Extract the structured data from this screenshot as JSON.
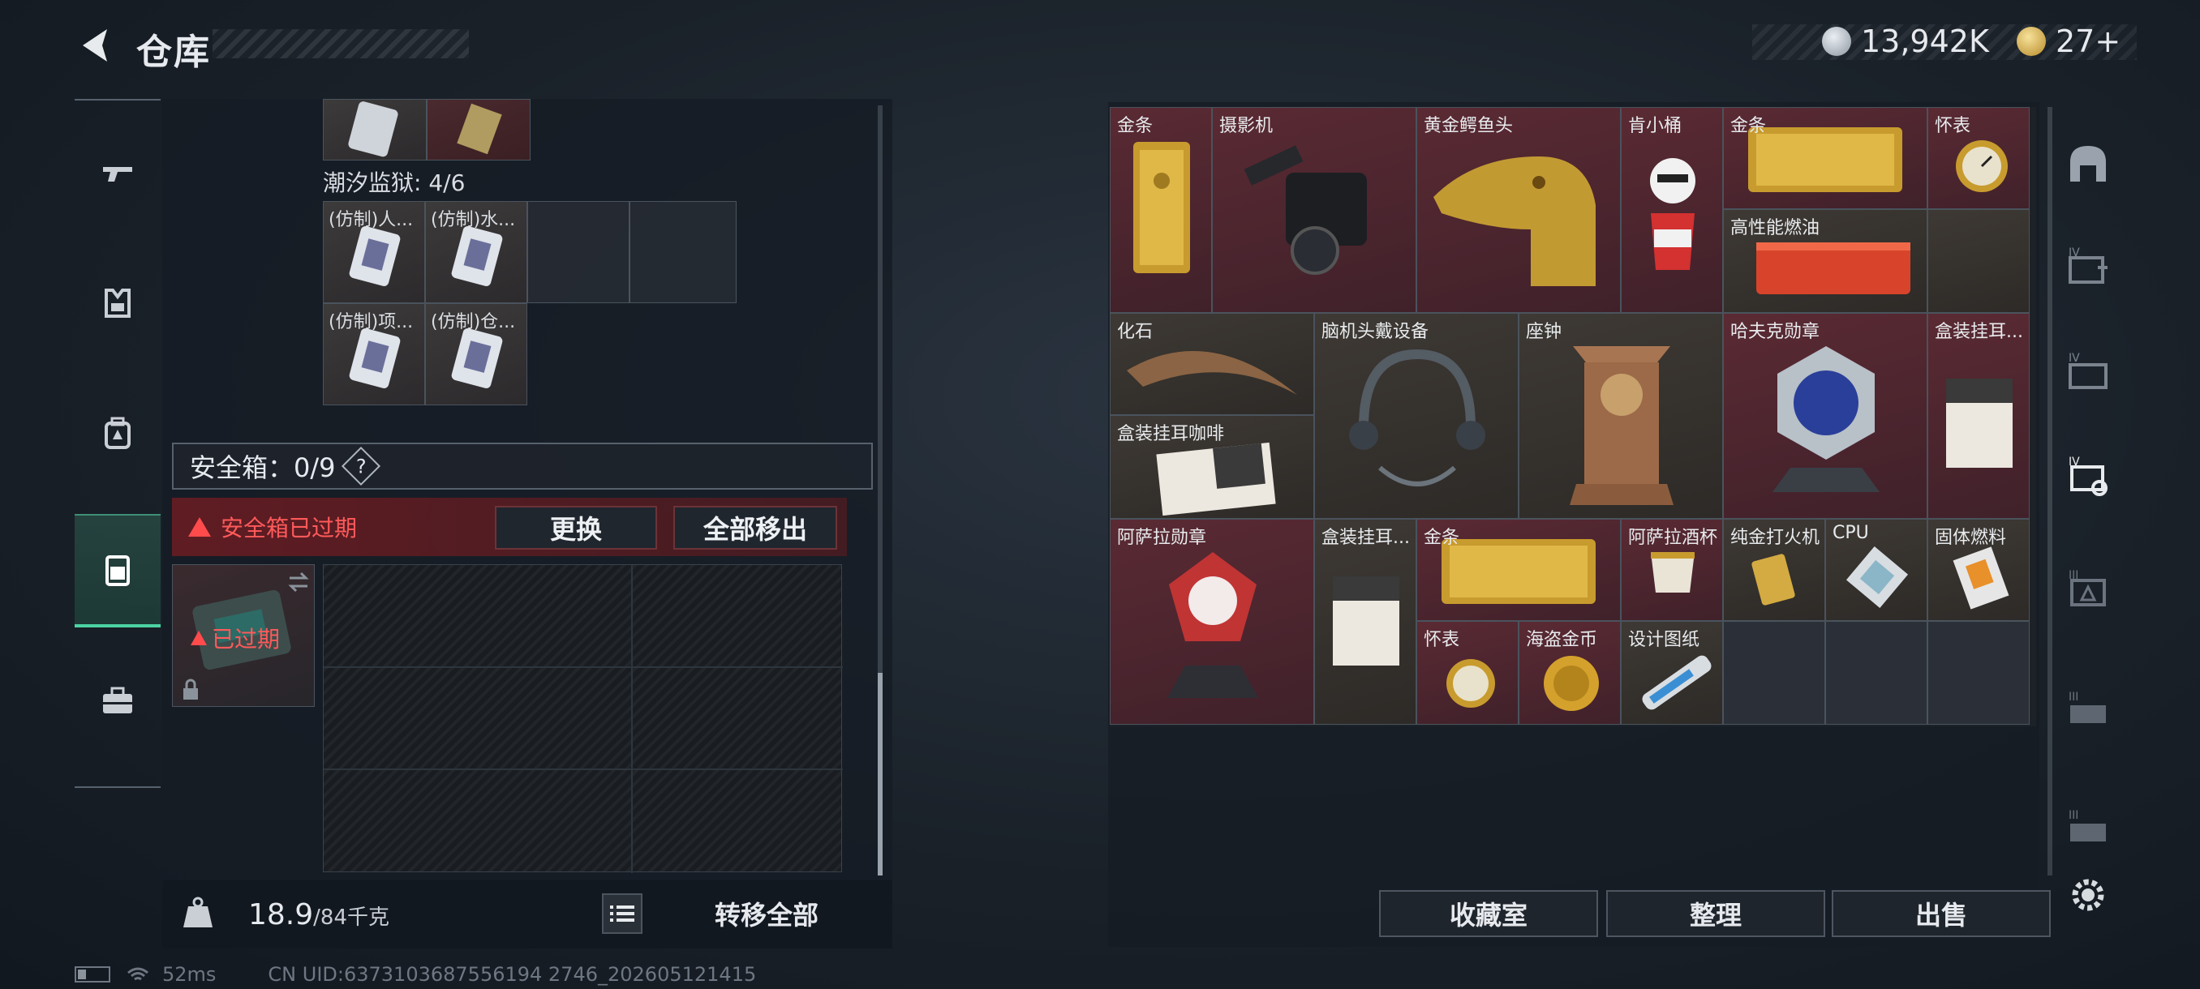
{
  "header": {
    "title": "仓库",
    "currency_silver": "13,942K",
    "currency_gold": "27+"
  },
  "left_panel": {
    "prison_label": "潮汐监狱: 4/6",
    "prison_items": [
      {
        "label": "(仿制)人..."
      },
      {
        "label": "(仿制)水..."
      },
      {
        "label": "(仿制)项..."
      },
      {
        "label": "(仿制)仓..."
      }
    ],
    "safebox_label": "安全箱：0/9",
    "help_symbol": "?",
    "expired_notice": "安全箱已过期",
    "replace_button": "更换",
    "remove_all_button": "全部移出",
    "slot_expired": "已过期",
    "weight_value": "18.9",
    "weight_capacity": "/84千克",
    "transfer_all_button": "转移全部"
  },
  "stash": {
    "items": [
      {
        "label": "金条"
      },
      {
        "label": "摄影机"
      },
      {
        "label": "黄金鳄鱼头"
      },
      {
        "label": "肯小桶"
      },
      {
        "label": "金条"
      },
      {
        "label": "怀表"
      },
      {
        "label": "高性能燃油"
      },
      {
        "label": "化石"
      },
      {
        "label": "脑机头戴设备"
      },
      {
        "label": "座钟"
      },
      {
        "label": "哈夫克勋章"
      },
      {
        "label": "盒装挂耳..."
      },
      {
        "label": "盒装挂耳咖啡"
      },
      {
        "label": "阿萨拉勋章"
      },
      {
        "label": "盒装挂耳..."
      },
      {
        "label": "金条"
      },
      {
        "label": "阿萨拉酒杯"
      },
      {
        "label": "纯金打火机"
      },
      {
        "label": "CPU"
      },
      {
        "label": "固体燃料"
      },
      {
        "label": "怀表"
      },
      {
        "label": "海盗金币"
      },
      {
        "label": "设计图纸"
      }
    ],
    "collection_button": "收藏室",
    "sort_button": "整理",
    "sell_button": "出售"
  },
  "right_rail": {
    "tiers": [
      "IV",
      "IV",
      "IV",
      "III",
      "III",
      "III"
    ]
  },
  "status_bar": {
    "ping": "52ms",
    "uid": "CN UID:6373103687556194 2746_202605121415"
  },
  "colors": {
    "accent": "#4cd3a3",
    "warning": "#ff4b4b",
    "rare_red": "#5a2a33"
  }
}
